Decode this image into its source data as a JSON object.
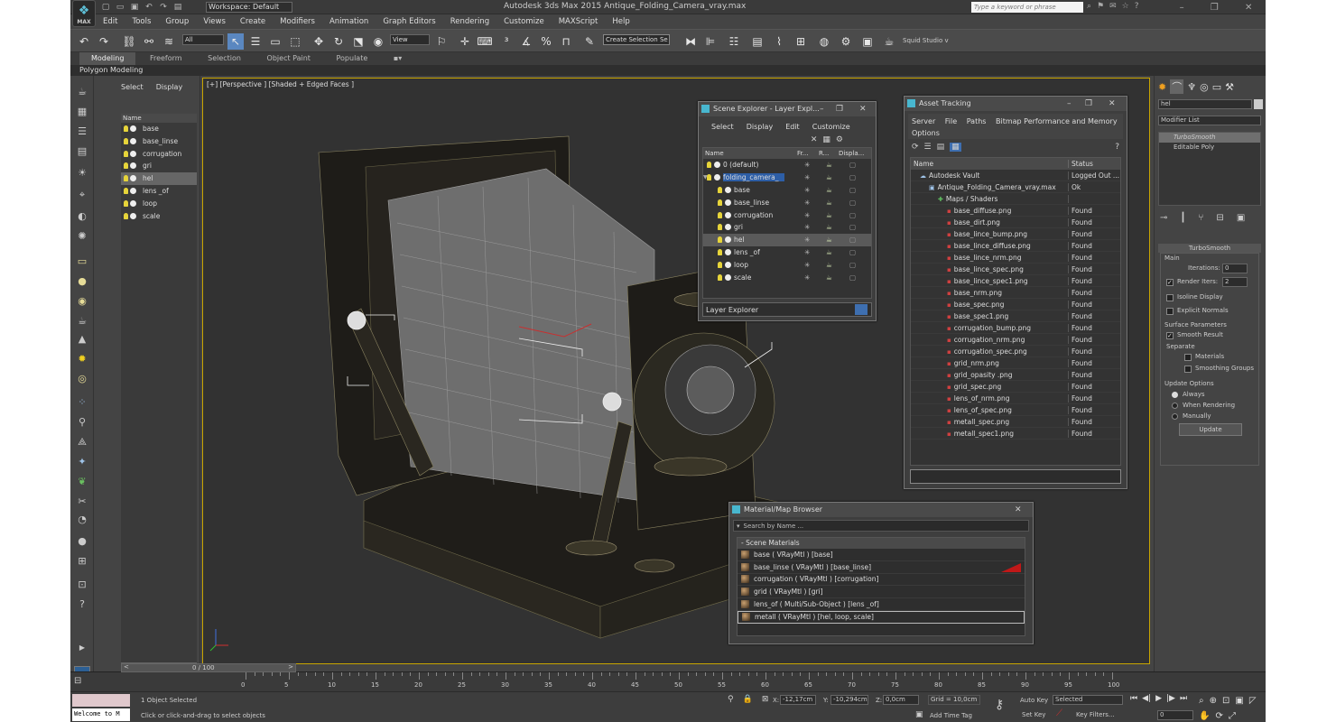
{
  "app": {
    "title": "Autodesk 3ds Max  2015    Antique_Folding_Camera_vray.max",
    "workspace": "Workspace: Default",
    "search_placeholder": "Type a keyword or phrase",
    "logo_text": "MAX"
  },
  "menu": [
    "Edit",
    "Tools",
    "Group",
    "Views",
    "Create",
    "Modifiers",
    "Animation",
    "Graph Editors",
    "Rendering",
    "Customize",
    "MAXScript",
    "Help"
  ],
  "toolbar": {
    "selection_filter": "All",
    "ref_coord": "View",
    "named_selection": "Create Selection Se",
    "squid": "Squid Studio v"
  },
  "ribbon": {
    "tabs": [
      "Modeling",
      "Freeform",
      "Selection",
      "Object Paint",
      "Populate"
    ],
    "sub_label": "Polygon Modeling"
  },
  "layer_panel": {
    "tabs": [
      "Select",
      "Display"
    ],
    "column": "Name",
    "items": [
      "base",
      "base_linse",
      "corrugation",
      "gri",
      "hel",
      "lens _of",
      "loop",
      "scale"
    ],
    "selected": "hel"
  },
  "viewport": {
    "label": "[+] [Perspective ] [Shaded + Edged Faces ]"
  },
  "scene_explorer": {
    "title": "Scene Explorer - Layer Expl...",
    "menu": [
      "Select",
      "Display",
      "Edit",
      "Customize"
    ],
    "columns": [
      "Name",
      "Fr...",
      "R...",
      "Displa..."
    ],
    "rows": [
      {
        "name": "0 (default)",
        "level": 0
      },
      {
        "name": "folding_camera_",
        "level": 0
      },
      {
        "name": "base",
        "level": 1
      },
      {
        "name": "base_linse",
        "level": 1
      },
      {
        "name": "corrugation",
        "level": 1
      },
      {
        "name": "gri",
        "level": 1
      },
      {
        "name": "hel",
        "level": 1
      },
      {
        "name": "lens _of",
        "level": 1
      },
      {
        "name": "loop",
        "level": 1
      },
      {
        "name": "scale",
        "level": 1
      }
    ],
    "footer": "Layer Explorer"
  },
  "asset_tracking": {
    "title": "Asset Tracking",
    "menu": [
      "Server",
      "File",
      "Paths",
      "Bitmap Performance and Memory",
      "Options"
    ],
    "columns": [
      "Name",
      "Status"
    ],
    "rows": [
      {
        "name": "Autodesk Vault",
        "status": "Logged Out ...",
        "indent": 1
      },
      {
        "name": "Antique_Folding_Camera_vray.max",
        "status": "Ok",
        "indent": 2
      },
      {
        "name": "Maps / Shaders",
        "status": "",
        "indent": 3
      },
      {
        "name": "base_diffuse.png",
        "status": "Found",
        "indent": 4
      },
      {
        "name": "base_dirt.png",
        "status": "Found",
        "indent": 4
      },
      {
        "name": "base_lince_bump.png",
        "status": "Found",
        "indent": 4
      },
      {
        "name": "base_lince_diffuse.png",
        "status": "Found",
        "indent": 4
      },
      {
        "name": "base_lince_nrm.png",
        "status": "Found",
        "indent": 4
      },
      {
        "name": "base_lince_spec.png",
        "status": "Found",
        "indent": 4
      },
      {
        "name": "base_lince_spec1.png",
        "status": "Found",
        "indent": 4
      },
      {
        "name": "base_nrm.png",
        "status": "Found",
        "indent": 4
      },
      {
        "name": "base_spec.png",
        "status": "Found",
        "indent": 4
      },
      {
        "name": "base_spec1.png",
        "status": "Found",
        "indent": 4
      },
      {
        "name": "corrugation_bump.png",
        "status": "Found",
        "indent": 4
      },
      {
        "name": "corrugation_nrm.png",
        "status": "Found",
        "indent": 4
      },
      {
        "name": "corrugation_spec.png",
        "status": "Found",
        "indent": 4
      },
      {
        "name": "grid_nrm.png",
        "status": "Found",
        "indent": 4
      },
      {
        "name": "grid_opasity .png",
        "status": "Found",
        "indent": 4
      },
      {
        "name": "grid_spec.png",
        "status": "Found",
        "indent": 4
      },
      {
        "name": "lens_of_nrm.png",
        "status": "Found",
        "indent": 4
      },
      {
        "name": "lens_of_spec.png",
        "status": "Found",
        "indent": 4
      },
      {
        "name": "metall_spec.png",
        "status": "Found",
        "indent": 4
      },
      {
        "name": "metall_spec1.png",
        "status": "Found",
        "indent": 4
      }
    ]
  },
  "material_browser": {
    "title": "Material/Map Browser",
    "search_placeholder": "Search by Name ...",
    "section": "- Scene Materials",
    "items": [
      "base  ( VRayMtl ) [base]",
      "base_linse  ( VRayMtl ) [base_linse]",
      "corrugation  ( VRayMtl ) [corrugation]",
      "grid  ( VRayMtl ) [gri]",
      "lens_of  ( Multi/Sub-Object ) [lens _of]",
      "metall  ( VRayMtl ) [hel, loop, scale]"
    ]
  },
  "command_panel": {
    "object_name": "hel",
    "modifier_list": "Modifier List",
    "stack": [
      "TurboSmooth",
      "Editable Poly"
    ],
    "rollout_title": "TurboSmooth",
    "main_label": "Main",
    "iterations_label": "Iterations:",
    "iterations_value": "0",
    "render_iters_label": "Render Iters:",
    "render_iters_value": "2",
    "isoline": "Isoline Display",
    "explicit": "Explicit Normals",
    "surface_params": "Surface Parameters",
    "smooth_result": "Smooth Result",
    "separate": "Separate",
    "materials": "Materials",
    "smoothing_groups": "Smoothing Groups",
    "update_options": "Update Options",
    "always": "Always",
    "when_rendering": "When Rendering",
    "manually": "Manually",
    "update_button": "Update"
  },
  "timeline": {
    "frame_counter": "0 / 100",
    "ticks": [
      "0",
      "5",
      "10",
      "15",
      "20",
      "25",
      "30",
      "35",
      "40",
      "45",
      "50",
      "55",
      "60",
      "65",
      "70",
      "75",
      "80",
      "85",
      "90",
      "95",
      "100"
    ]
  },
  "status": {
    "maxscript": "Welcome to M",
    "selected": "1 Object Selected",
    "prompt": "Click or click-and-drag to select objects",
    "x_label": "X:",
    "x": "-12,17cm",
    "y_label": "Y:",
    "y": "-10,294cm",
    "z_label": "Z:",
    "z": "0,0cm",
    "grid": "Grid = 10,0cm",
    "auto_key": "Auto Key",
    "set_key": "Set Key",
    "selected_dropdown": "Selected",
    "key_filters": "Key Filters...",
    "add_time_tag": "Add Time Tag",
    "frame": "0"
  }
}
